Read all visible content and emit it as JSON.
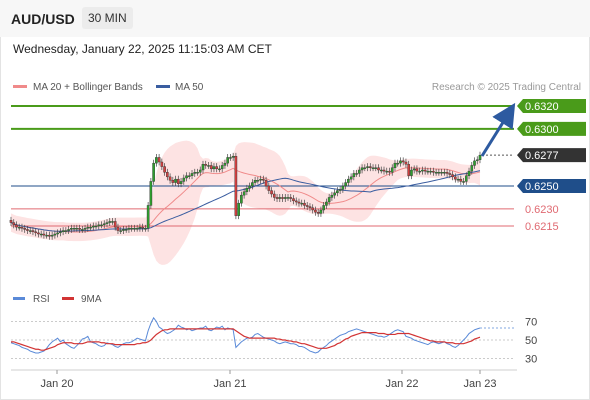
{
  "header": {
    "symbol": "AUD/USD",
    "timeframe": "30 MIN"
  },
  "datetime": "Wednesday, January 22, 2025 11:15:03 AM CET",
  "legend": {
    "ma20_label": "MA 20 + Bollinger Bands",
    "ma50_label": "MA 50",
    "copyright": "Research © 2025 Trading Central"
  },
  "colors": {
    "resistance": "#4a9b1a",
    "pivot": "#1f4e8a",
    "support": "#e06a72",
    "current": "#333333",
    "bollinger_fill": "#fde3e3",
    "ma20": "#f08a8a",
    "ma50": "#3a5da0",
    "candle_up": "#2e9e2e",
    "candle_down": "#d24040",
    "rsi": "#5a8ad8",
    "rsi_ma": "#d23434",
    "arrow": "#2d5aa0"
  },
  "chart_data": [
    {
      "type": "candlestick",
      "x_labels": [
        "Jan 20",
        "Jan 21",
        "Jan 22",
        "Jan 23"
      ],
      "ylim": [
        0.6195,
        0.634
      ],
      "levels": [
        {
          "name": "resistance",
          "value": 0.632,
          "label": "0.6320"
        },
        {
          "name": "resistance",
          "value": 0.63,
          "label": "0.6300"
        },
        {
          "name": "current",
          "value": 0.6277,
          "label": "0.6277"
        },
        {
          "name": "pivot",
          "value": 0.625,
          "label": "0.6250"
        },
        {
          "name": "support",
          "value": 0.623,
          "label": "0.6230"
        },
        {
          "name": "support",
          "value": 0.6215,
          "label": "0.6215"
        }
      ],
      "close_series": [
        0.6218,
        0.6216,
        0.6214,
        0.6214,
        0.6213,
        0.6212,
        0.6211,
        0.6211,
        0.621,
        0.6209,
        0.6208,
        0.6208,
        0.6207,
        0.6207,
        0.6206,
        0.6207,
        0.6208,
        0.6209,
        0.621,
        0.6211,
        0.6211,
        0.6212,
        0.6213,
        0.6213,
        0.6213,
        0.6212,
        0.6212,
        0.6213,
        0.6214,
        0.6214,
        0.6215,
        0.6215,
        0.6216,
        0.6216,
        0.6217,
        0.6218,
        0.6219,
        0.6219,
        0.6214,
        0.6211,
        0.6211,
        0.6212,
        0.6212,
        0.6213,
        0.6213,
        0.6213,
        0.6213,
        0.6214,
        0.6213,
        0.6213,
        0.6233,
        0.6254,
        0.627,
        0.6275,
        0.6271,
        0.6267,
        0.6262,
        0.6258,
        0.6255,
        0.6253,
        0.6256,
        0.6252,
        0.6254,
        0.6257,
        0.6259,
        0.6259,
        0.6261,
        0.6262,
        0.6262,
        0.6264,
        0.6269,
        0.6268,
        0.6268,
        0.6265,
        0.6267,
        0.6265,
        0.6265,
        0.6268,
        0.627,
        0.6275,
        0.6275,
        0.6276,
        0.6224,
        0.6235,
        0.6242,
        0.6245,
        0.6248,
        0.625,
        0.6253,
        0.6255,
        0.6255,
        0.6256,
        0.6255,
        0.625,
        0.6246,
        0.6243,
        0.624,
        0.6239,
        0.624,
        0.6239,
        0.624,
        0.624,
        0.6239,
        0.6237,
        0.6236,
        0.6235,
        0.6235,
        0.6233,
        0.6232,
        0.6231,
        0.6229,
        0.6227,
        0.6226,
        0.6229,
        0.6233,
        0.6236,
        0.624,
        0.6242,
        0.6244,
        0.6246,
        0.6247,
        0.625,
        0.6253,
        0.6256,
        0.6258,
        0.6261,
        0.6261,
        0.6264,
        0.6266,
        0.6266,
        0.6267,
        0.6266,
        0.6266,
        0.6266,
        0.6264,
        0.6264,
        0.6263,
        0.6263,
        0.6262,
        0.6266,
        0.627,
        0.627,
        0.6272,
        0.6271,
        0.6269,
        0.6259,
        0.6264,
        0.6265,
        0.6263,
        0.6263,
        0.6264,
        0.6263,
        0.6263,
        0.6263,
        0.6262,
        0.6262,
        0.6262,
        0.6262,
        0.6262,
        0.6261,
        0.626,
        0.6258,
        0.6256,
        0.6256,
        0.6254,
        0.6254,
        0.6259,
        0.6263,
        0.6268,
        0.6272,
        0.6273,
        0.6277
      ]
    },
    {
      "type": "line",
      "title": "RSI",
      "ticks": [
        30,
        50,
        70
      ],
      "ylim": [
        25,
        80
      ],
      "series": [
        {
          "name": "RSI",
          "values": [
            47,
            46,
            45,
            44,
            42,
            41,
            40,
            38,
            37,
            36,
            36,
            37,
            38,
            41,
            45,
            48,
            50,
            52,
            48,
            50,
            46,
            44,
            42,
            41,
            44,
            47,
            51,
            52,
            54,
            48,
            47,
            46,
            44,
            43,
            44,
            47,
            46,
            45,
            43,
            42,
            44,
            46,
            47,
            47,
            48,
            50,
            52,
            51,
            50,
            49,
            60,
            68,
            74,
            70,
            64,
            62,
            59,
            57,
            58,
            60,
            62,
            66,
            64,
            63,
            61,
            62,
            60,
            61,
            62,
            63,
            63,
            65,
            61,
            60,
            62,
            64,
            63,
            65,
            61,
            63,
            62,
            61,
            42,
            45,
            48,
            50,
            52,
            52,
            53,
            56,
            57,
            55,
            53,
            52,
            51,
            50,
            49,
            47,
            46,
            47,
            48,
            47,
            46,
            46,
            45,
            43,
            43,
            42,
            40,
            38,
            37,
            36,
            37,
            40,
            42,
            44,
            47,
            49,
            51,
            53,
            55,
            56,
            57,
            59,
            60,
            61,
            62,
            61,
            60,
            59,
            58,
            57,
            56,
            55,
            54,
            54,
            53,
            54,
            56,
            58,
            60,
            61,
            60,
            59,
            54,
            53,
            52,
            50,
            49,
            48,
            47,
            46,
            45,
            47,
            48,
            47,
            46,
            47,
            48,
            46,
            45,
            43,
            42,
            44,
            47,
            50,
            53,
            57,
            59,
            61,
            62,
            63
          ]
        },
        {
          "name": "9MA",
          "values": [
            48,
            48,
            47,
            46,
            45,
            44,
            43,
            42,
            41,
            40,
            40,
            39,
            39,
            40,
            41,
            42,
            43,
            45,
            46,
            47,
            47,
            47,
            47,
            46,
            46,
            46,
            46,
            47,
            48,
            48,
            48,
            48,
            48,
            47,
            47,
            46,
            46,
            46,
            45,
            45,
            45,
            45,
            45,
            45,
            45,
            45,
            46,
            46,
            47,
            47,
            48,
            50,
            53,
            56,
            58,
            60,
            61,
            61,
            62,
            62,
            62,
            62,
            62,
            62,
            62,
            62,
            62,
            62,
            62,
            62,
            62,
            62,
            62,
            62,
            62,
            62,
            62,
            62,
            62,
            62,
            62,
            62,
            60,
            58,
            56,
            54,
            53,
            52,
            52,
            52,
            52,
            52,
            52,
            52,
            52,
            52,
            52,
            51,
            51,
            50,
            50,
            49,
            49,
            48,
            48,
            47,
            46,
            46,
            45,
            44,
            43,
            42,
            41,
            41,
            41,
            41,
            42,
            43,
            44,
            46,
            47,
            49,
            51,
            52,
            54,
            55,
            56,
            57,
            58,
            58,
            58,
            58,
            58,
            58,
            57,
            57,
            57,
            56,
            56,
            56,
            56,
            57,
            57,
            57,
            57,
            57,
            56,
            55,
            54,
            53,
            52,
            51,
            50,
            49,
            49,
            48,
            48,
            48,
            48,
            47,
            47,
            47,
            46,
            46,
            46,
            46,
            47,
            48,
            49,
            51,
            52,
            53
          ]
        }
      ]
    }
  ],
  "x_labels": [
    "Jan 20",
    "Jan 21",
    "Jan 22",
    "Jan 23"
  ],
  "rsi_legend": {
    "rsi_label": "RSI",
    "ma_label": "9MA"
  },
  "rsi_ticks": [
    "70",
    "50",
    "30"
  ]
}
